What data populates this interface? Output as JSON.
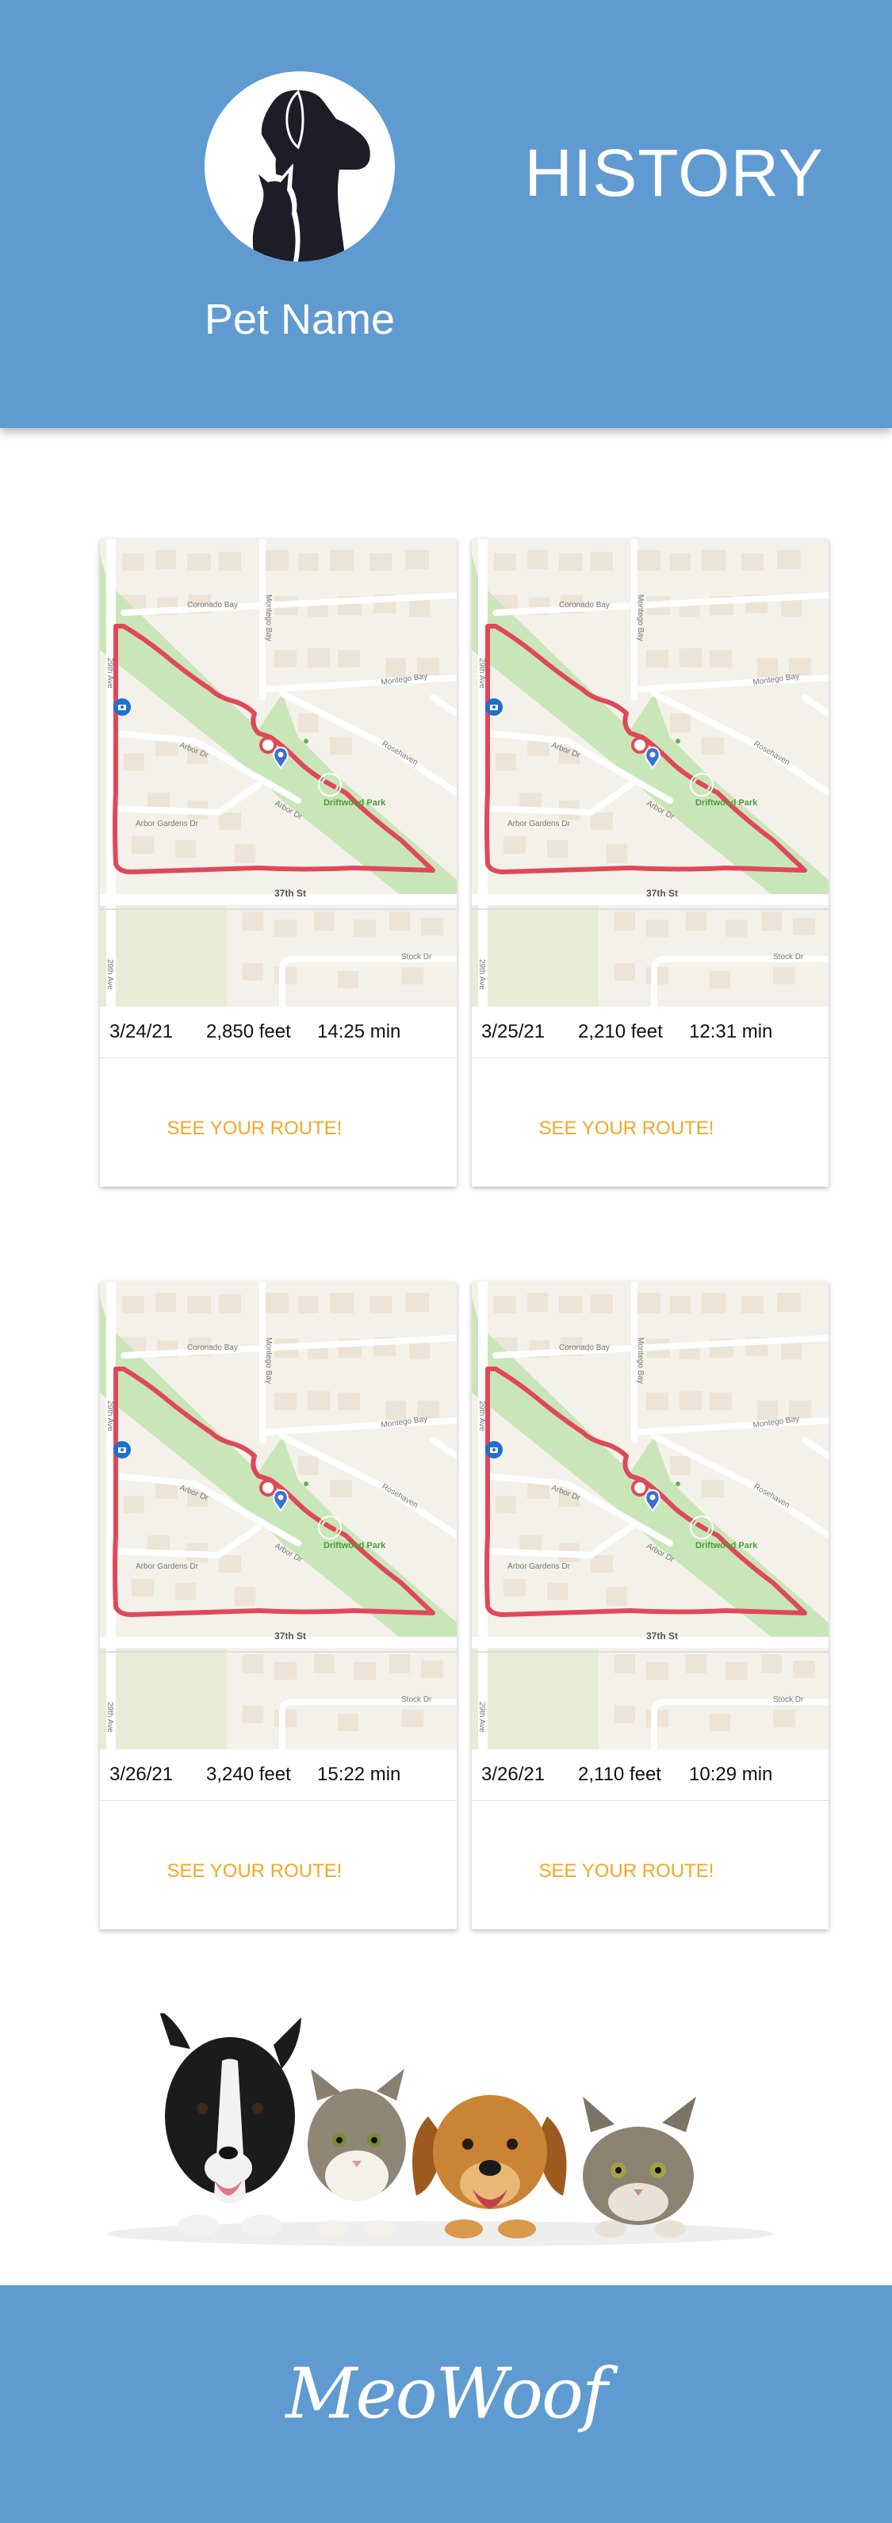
{
  "header": {
    "pet_name": "Pet Name",
    "title": "HISTORY"
  },
  "map_labels": {
    "street_top": "Coronado Bay",
    "street_vertical": "Montego Bay",
    "street_right": "Montego Bay",
    "street_left": "29th Ave",
    "street_arbor": "Arbor Dr",
    "street_arbor2": "Arbor Gardens Dr",
    "street_rosehaven": "Rosehaven",
    "park": "Driftwood Park",
    "street_bottom": "37th St",
    "street_stock": "Stock Dr"
  },
  "walks": [
    {
      "date": "3/24/21",
      "distance": "2,850 feet",
      "duration": "14:25 min",
      "cta": "SEE YOUR ROUTE!"
    },
    {
      "date": "3/25/21",
      "distance": "2,210 feet",
      "duration": "12:31 min",
      "cta": "SEE YOUR ROUTE!"
    },
    {
      "date": "3/26/21",
      "distance": "3,240 feet",
      "duration": "15:22 min",
      "cta": "SEE YOUR ROUTE!"
    },
    {
      "date": "3/26/21",
      "distance": "2,110 feet",
      "duration": "10:29 min",
      "cta": "SEE YOUR ROUTE!"
    }
  ],
  "footer": {
    "brand": "MeoWoof"
  },
  "colors": {
    "brand_blue": "#5f9bd1",
    "cta_orange": "#f5a623",
    "route_red": "#e0485a",
    "park_green": "#c9e6b8",
    "map_base": "#f4f1ea"
  },
  "icons": {
    "avatar": "dog-cat-silhouette-icon",
    "start_marker": "camera-pin-icon",
    "current_marker": "location-pin-icon"
  }
}
